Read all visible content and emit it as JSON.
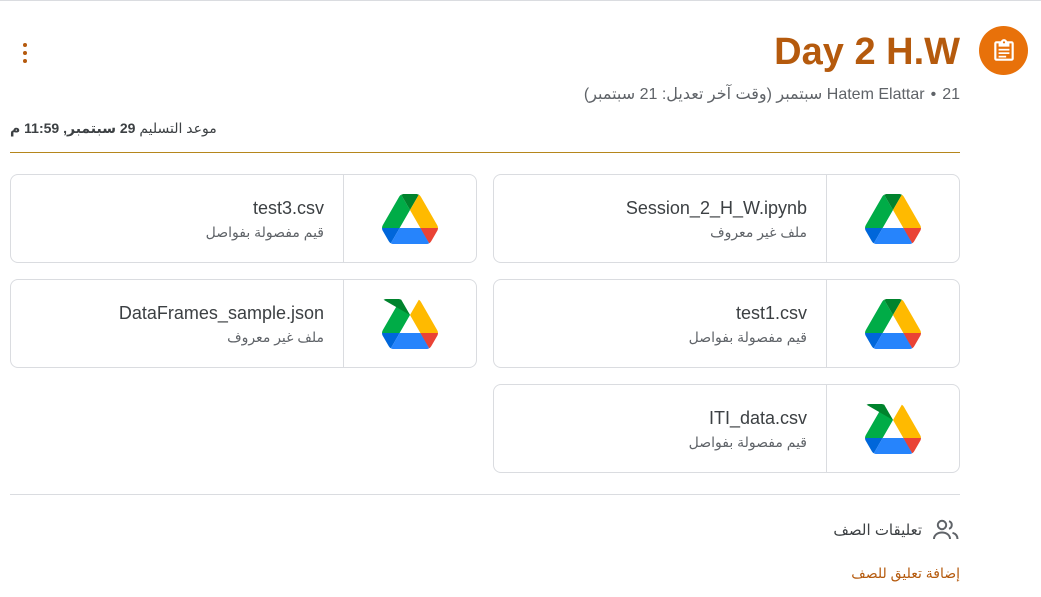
{
  "assignment": {
    "title": "Day 2 H.W",
    "author": "Hatem Elattar",
    "posted_date": "21 سبتمبر",
    "edited_note": "(وقت آخر تعديل: 21 سبتمبر)",
    "due_label": "موعد التسليم",
    "due_value": "29 سبتمبر, 11:59 م",
    "icon": "assignment-icon",
    "accent_color": "#b55a0d",
    "icon_bg_color": "#e8710a"
  },
  "attachments": [
    {
      "name": "Session_2_H_W.ipynb",
      "type": "ملف غير معروف",
      "icon": "google-drive-icon"
    },
    {
      "name": "test3.csv",
      "type": "قيم مفصولة بفواصل",
      "icon": "google-drive-icon"
    },
    {
      "name": "test1.csv",
      "type": "قيم مفصولة بفواصل",
      "icon": "google-drive-icon"
    },
    {
      "name": "DataFrames_sample.json",
      "type": "ملف غير معروف",
      "icon": "google-drive-icon"
    },
    {
      "name": "ITI_data.csv",
      "type": "قيم مفصولة بفواصل",
      "icon": "google-drive-icon"
    }
  ],
  "comments": {
    "heading": "تعليقات الصف",
    "add_label": "إضافة تعليق للصف",
    "icon": "people-icon"
  },
  "menu": {
    "icon": "more-vert-icon"
  }
}
